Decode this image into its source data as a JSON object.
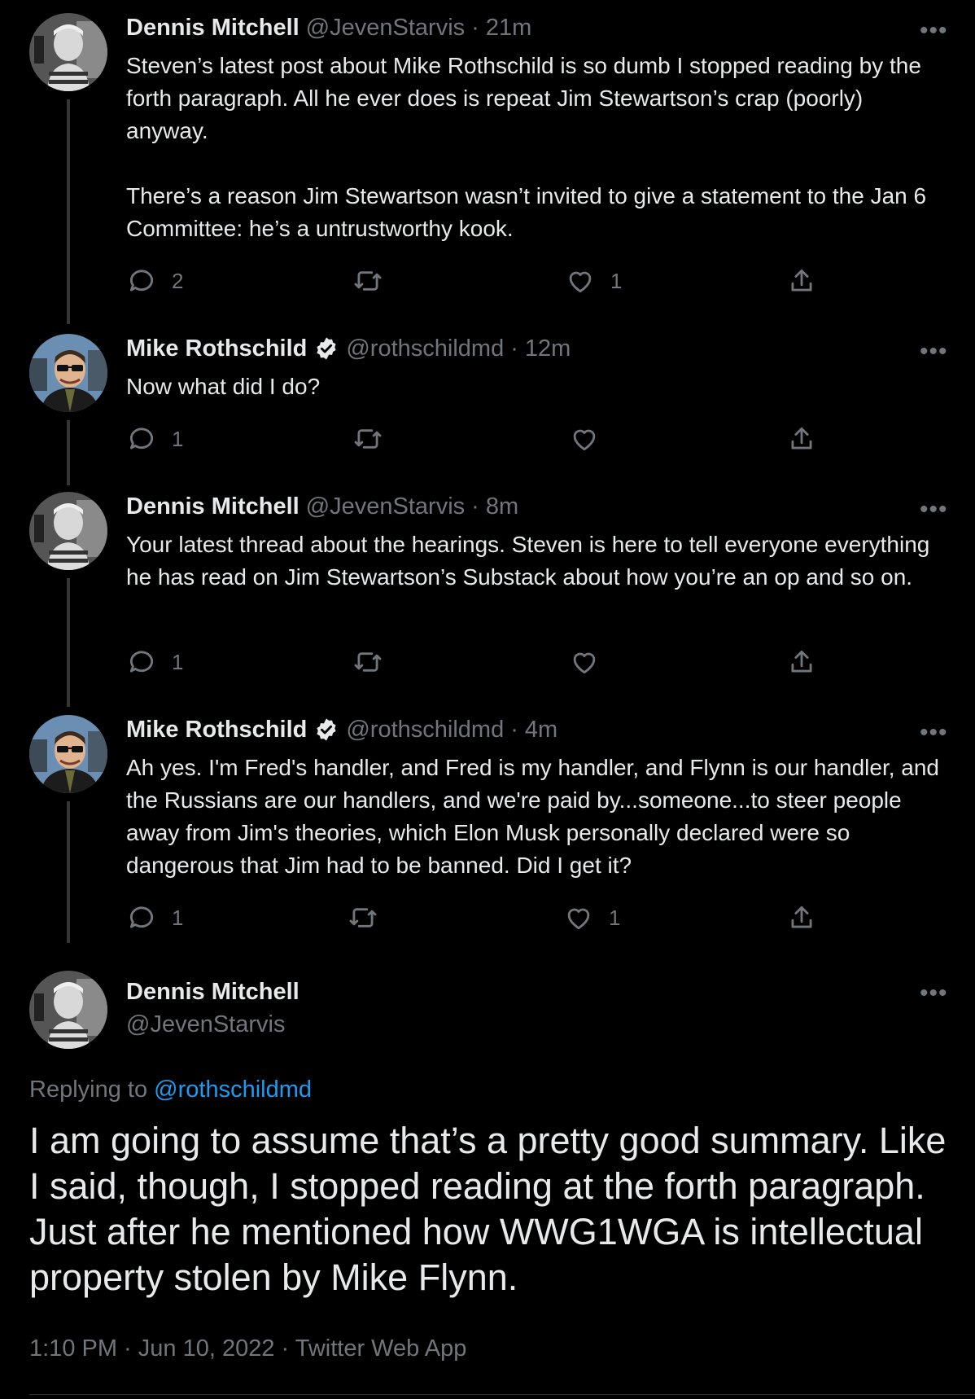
{
  "tweets": [
    {
      "name": "Dennis Mitchell",
      "handle": "@JevenStarvis",
      "time": "21m",
      "verified": false,
      "paragraphs": [
        "Steven’s latest post about Mike Rothschild is so dumb I stopped reading by the forth paragraph. All he ever does is repeat Jim Stewartson’s crap (poorly) anyway.",
        "There’s a reason Jim Stewartson wasn’t invited to give a statement to the Jan 6 Committee: he’s a untrustworthy kook."
      ],
      "replies": "2",
      "retweets": "",
      "likes": "1"
    },
    {
      "name": "Mike Rothschild",
      "handle": "@rothschildmd",
      "time": "12m",
      "verified": true,
      "paragraphs": [
        "Now what did I do?"
      ],
      "replies": "1",
      "retweets": "",
      "likes": ""
    },
    {
      "name": "Dennis Mitchell",
      "handle": "@JevenStarvis",
      "time": "8m",
      "verified": false,
      "paragraphs": [
        "Your latest thread about the hearings. Steven is here to tell everyone everything he has read on Jim Stewartson’s Substack about how you’re an op and so on."
      ],
      "replies": "1",
      "retweets": "",
      "likes": ""
    },
    {
      "name": "Mike Rothschild",
      "handle": "@rothschildmd",
      "time": "4m",
      "verified": true,
      "paragraphs": [
        "Ah yes. I'm Fred's handler, and Fred is my handler, and Flynn is our handler, and the Russians are our handlers, and we're paid by...someone...to steer people away from Jim's theories, which Elon Musk personally declared were so dangerous that Jim had to be banned. Did I get it?"
      ],
      "replies": "1",
      "retweets": "",
      "likes": "1"
    }
  ],
  "focused": {
    "name": "Dennis Mitchell",
    "handle": "@JevenStarvis",
    "replying_label": "Replying to ",
    "replying_to": "@rothschildmd",
    "text": "I am going to assume that’s a pretty good summary. Like I said, though, I stopped reading at the forth paragraph. Just after he mentioned how WWG1WGA is intellectual property stolen by Mike Flynn.",
    "meta": "1:10 PM · Jun 10, 2022 · Twitter Web App"
  },
  "icons": {
    "more": "more-horizontal-icon",
    "reply": "reply-icon",
    "retweet": "retweet-icon",
    "like": "heart-icon",
    "share": "share-icon",
    "verified": "verified-badge-icon"
  },
  "colors": {
    "background": "#000000",
    "text": "#e7e9ea",
    "muted": "#71767b",
    "link": "#1d9bf0",
    "thread_line": "#333639"
  },
  "more_glyph": "•••",
  "dot": "·"
}
